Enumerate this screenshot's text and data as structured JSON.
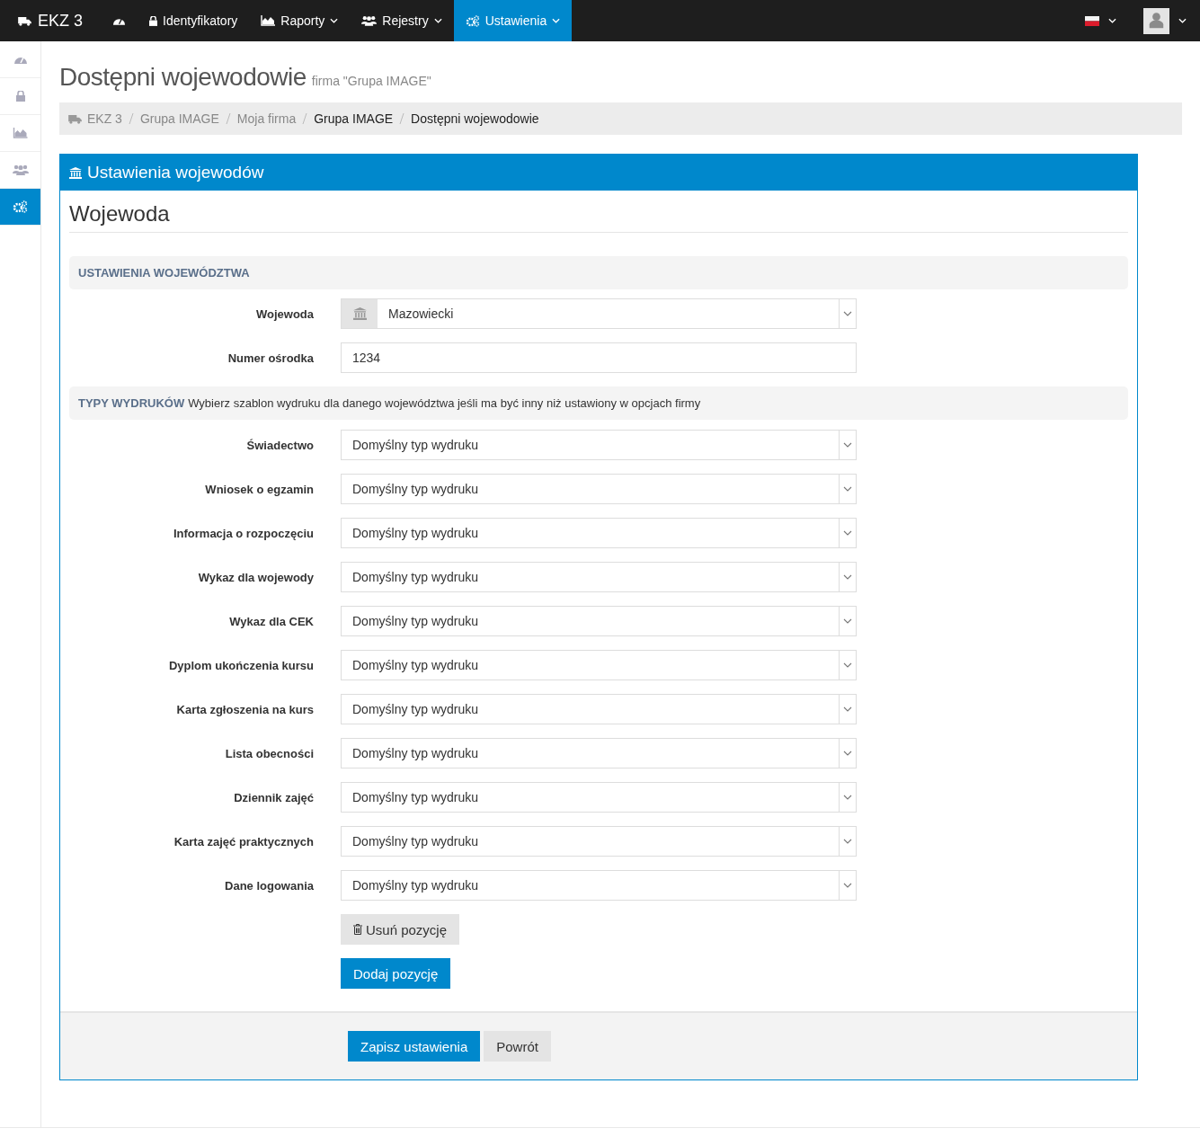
{
  "navbar": {
    "brand": "EKZ 3",
    "items": [
      {
        "dropdown": false,
        "selected": false
      },
      {
        "label": "Identyfikatory",
        "dropdown": false,
        "selected": false
      },
      {
        "label": "Raporty",
        "dropdown": true,
        "selected": false
      },
      {
        "label": "Rejestry",
        "dropdown": true,
        "selected": false
      },
      {
        "label": "Ustawienia",
        "dropdown": true,
        "selected": true
      }
    ]
  },
  "sidebar": {
    "items": [
      {
        "selected": false
      },
      {
        "selected": false
      },
      {
        "selected": false
      },
      {
        "selected": false
      },
      {
        "selected": true
      }
    ]
  },
  "page": {
    "title": "Dostępni wojewodowie",
    "subtitle": "firma \"Grupa IMAGE\""
  },
  "breadcrumb": [
    {
      "label": "EKZ 3",
      "link": true
    },
    {
      "label": "Grupa IMAGE",
      "link": true
    },
    {
      "label": "Moja firma",
      "link": true
    },
    {
      "label": "Grupa IMAGE",
      "link": false
    },
    {
      "label": "Dostępni wojewodowie",
      "link": false
    }
  ],
  "panel": {
    "title": "Ustawienia wojewodów",
    "heading": "Wojewoda",
    "section1": {
      "title": "USTAWIENIA WOJEWÓDZTWA"
    },
    "fields": [
      {
        "label": "Wojewoda",
        "kind": "addon-select",
        "value": "Mazowiecki"
      },
      {
        "label": "Numer ośrodka",
        "kind": "text",
        "value": "1234"
      }
    ],
    "section2": {
      "title": "TYPY WYDRUKÓW",
      "description": "Wybierz szablon wydruku dla danego województwa jeśli ma być inny niż ustawiony w opcjach firmy"
    },
    "print_types": [
      {
        "label": "Świadectwo",
        "value": "Domyślny typ wydruku"
      },
      {
        "label": "Wniosek o egzamin",
        "value": "Domyślny typ wydruku"
      },
      {
        "label": "Informacja o rozpoczęciu",
        "value": "Domyślny typ wydruku"
      },
      {
        "label": "Wykaz dla wojewody",
        "value": "Domyślny typ wydruku"
      },
      {
        "label": "Wykaz dla CEK",
        "value": "Domyślny typ wydruku"
      },
      {
        "label": "Dyplom ukończenia kursu",
        "value": "Domyślny typ wydruku"
      },
      {
        "label": "Karta zgłoszenia na kurs",
        "value": "Domyślny typ wydruku"
      },
      {
        "label": "Lista obecności",
        "value": "Domyślny typ wydruku"
      },
      {
        "label": "Dziennik zajęć",
        "value": "Domyślny typ wydruku"
      },
      {
        "label": "Karta zajęć praktycznych",
        "value": "Domyślny typ wydruku"
      },
      {
        "label": "Dane logowania",
        "value": "Domyślny typ wydruku"
      }
    ],
    "remove_button": "Usuń pozycję",
    "add_button": "Dodaj pozycję",
    "save_button": "Zapisz ustawienia",
    "back_button": "Powrót"
  }
}
